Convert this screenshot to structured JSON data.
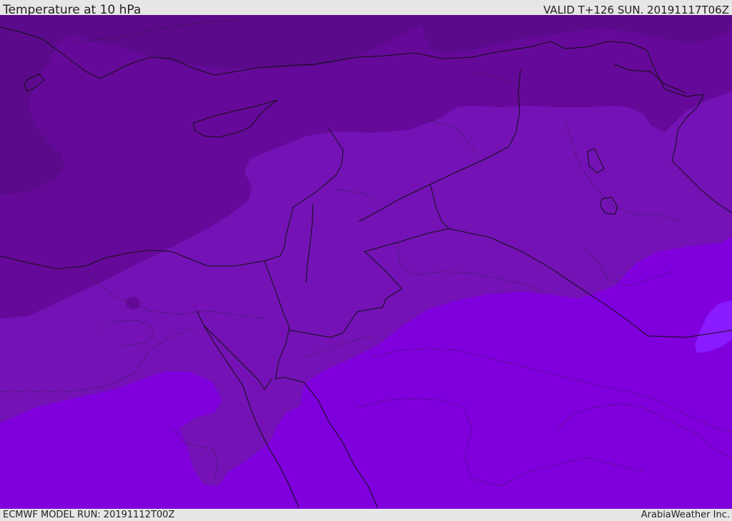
{
  "header": {
    "title": "Temperature at 10 hPa",
    "valid": "VALID T+126 SUN. 20191117T06Z"
  },
  "footer": {
    "model_run": "ECMWF MODEL RUN: 20191112T00Z",
    "credit": "ArabiaWeather Inc."
  },
  "map": {
    "variable": "Temperature",
    "level": "10 hPa",
    "colors": {
      "band_darkest": "#5a0a8a",
      "band_dark": "#65099a",
      "band_mid": "#7412b6",
      "band_light": "#7f00dd",
      "band_lightest": "#8a1aff",
      "lines": "#111111"
    }
  }
}
